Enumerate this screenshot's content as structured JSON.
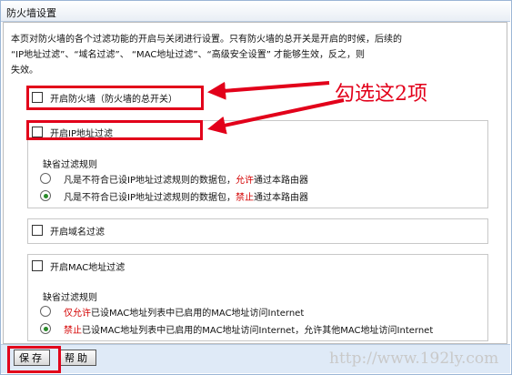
{
  "window": {
    "title": "防火墙设置"
  },
  "intro": {
    "line1": "本页对防火墙的各个过滤功能的开启与关闭进行设置。只有防火墙的总开关是开启的时候，后续的",
    "line2": "“IP地址过滤”、“域名过滤”、 “MAC地址过滤”、“高级安全设置” 才能够生效，反之，则",
    "line3": "失效。"
  },
  "firewall": {
    "label": "开启防火墙（防火墙的总开关）",
    "checked": false
  },
  "ip_filter": {
    "label": "开启IP地址过滤",
    "checked": false,
    "rule_title": "缺省过滤规则",
    "option_allow": {
      "pre": "凡是不符合已设IP地址过滤规则的数据包，",
      "hl": "允许",
      "post": "通过本路由器",
      "selected": false
    },
    "option_deny": {
      "pre": "凡是不符合已设IP地址过滤规则的数据包，",
      "hl": "禁止",
      "post": "通过本路由器",
      "selected": true
    }
  },
  "domain_filter": {
    "label": "开启域名过滤",
    "checked": false
  },
  "mac_filter": {
    "label": "开启MAC地址过滤",
    "checked": false,
    "rule_title": "缺省过滤规则",
    "option_allow": {
      "hl": "仅允许",
      "post": "已设MAC地址列表中已启用的MAC地址访问Internet",
      "selected": false
    },
    "option_deny": {
      "hl": "禁止",
      "post": "已设MAC地址列表中已启用的MAC地址访问Internet，允许其他MAC地址访问Internet",
      "selected": true
    }
  },
  "buttons": {
    "save": "保存",
    "help": "帮助"
  },
  "annotation": "勾选这2项",
  "watermark": "http://www.192ly.com",
  "colors": {
    "highlight": "#d40000",
    "annotation": "#e2001a",
    "selected_radio": "#2a8a2a"
  }
}
